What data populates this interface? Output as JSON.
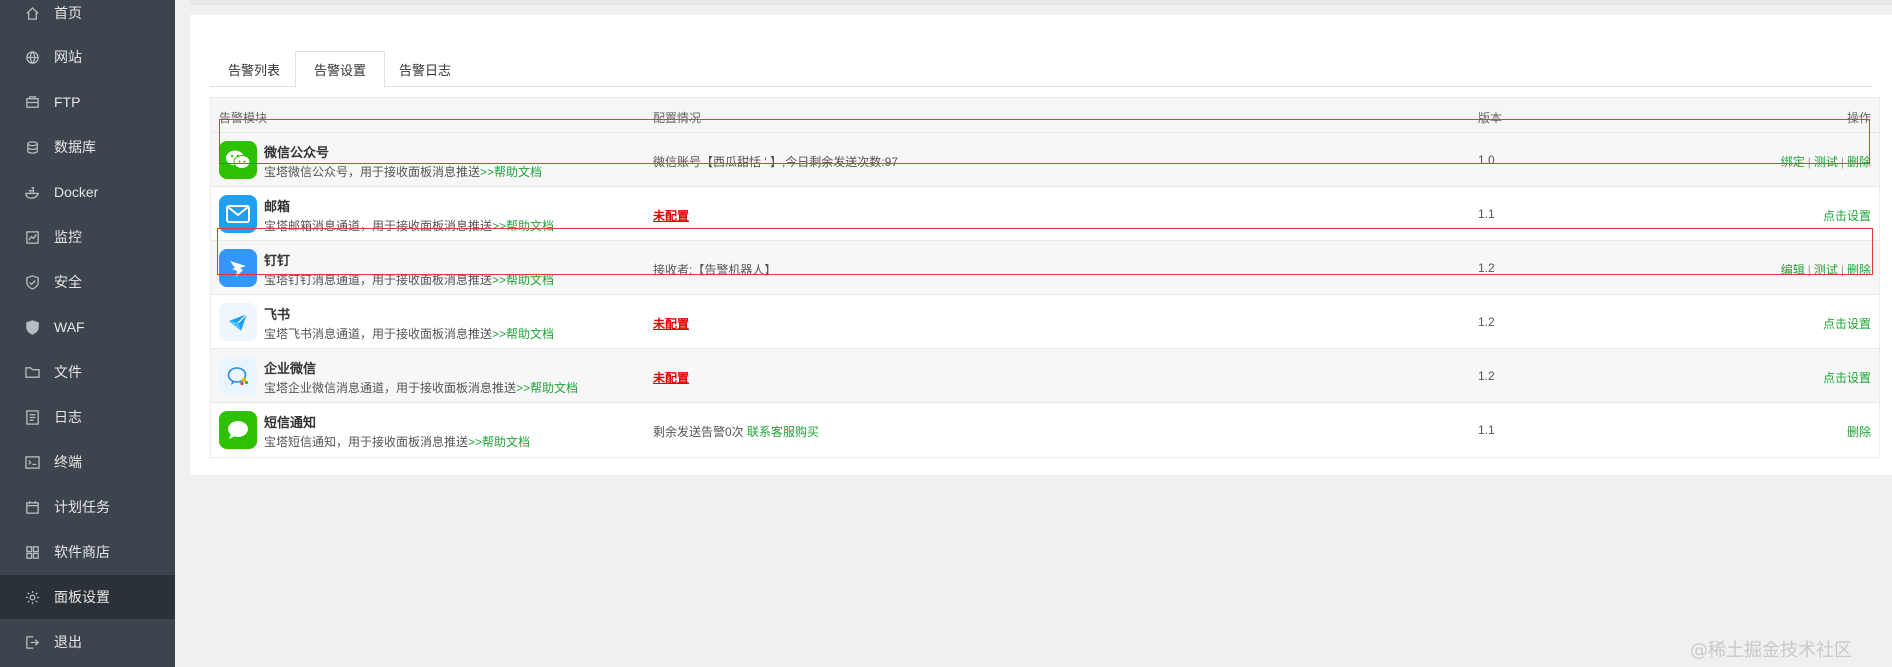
{
  "sidebar": {
    "items": [
      {
        "label": "首页",
        "icon": "home-icon"
      },
      {
        "label": "网站",
        "icon": "globe-icon"
      },
      {
        "label": "FTP",
        "icon": "ftp-icon"
      },
      {
        "label": "数据库",
        "icon": "database-icon"
      },
      {
        "label": "Docker",
        "icon": "docker-icon"
      },
      {
        "label": "监控",
        "icon": "monitor-icon"
      },
      {
        "label": "安全",
        "icon": "shield-icon"
      },
      {
        "label": "WAF",
        "icon": "waf-shield-icon"
      },
      {
        "label": "文件",
        "icon": "folder-icon"
      },
      {
        "label": "日志",
        "icon": "log-icon"
      },
      {
        "label": "终端",
        "icon": "terminal-icon"
      },
      {
        "label": "计划任务",
        "icon": "calendar-icon"
      },
      {
        "label": "软件商店",
        "icon": "grid-icon"
      },
      {
        "label": "面板设置",
        "icon": "gear-icon"
      },
      {
        "label": "退出",
        "icon": "logout-icon"
      }
    ],
    "active_index": 13
  },
  "tabs": [
    {
      "label": "告警列表"
    },
    {
      "label": "告警设置"
    },
    {
      "label": "告警日志"
    }
  ],
  "active_tab": 1,
  "table": {
    "headers": {
      "module": "告警模块",
      "config": "配置情况",
      "version": "版本",
      "ops": "操作"
    },
    "help_link": ">>帮助文档",
    "rows": [
      {
        "title": "微信公众号",
        "desc": "宝塔微信公众号，用于接收面板消息推送",
        "config": "微信账号【西瓜甜恬 ' 】,今日剩余发送次数:97",
        "version": "1.0",
        "ops": [
          "绑定",
          "测试",
          "删除"
        ],
        "icon": "wechat-icon",
        "icon_bg": "#2dc100"
      },
      {
        "title": "邮箱",
        "desc": "宝塔邮箱消息通道，用于接收面板消息推送",
        "config_unset": "未配置",
        "version": "1.1",
        "ops": [
          "点击设置"
        ],
        "icon": "mail-icon",
        "icon_bg": "#1e9ff2"
      },
      {
        "title": "钉钉",
        "desc": "宝塔钉钉消息通道，用于接收面板消息推送",
        "config": "接收者:【告警机器人】",
        "version": "1.2",
        "ops": [
          "编辑",
          "测试",
          "删除"
        ],
        "icon": "dingtalk-icon",
        "icon_bg": "#3296fa"
      },
      {
        "title": "飞书",
        "desc": "宝塔飞书消息通道，用于接收面板消息推送",
        "config_unset": "未配置",
        "version": "1.2",
        "ops": [
          "点击设置"
        ],
        "icon": "feishu-icon",
        "icon_bg": "#eef6fb"
      },
      {
        "title": "企业微信",
        "desc": "宝塔企业微信消息通道，用于接收面板消息推送",
        "config_unset": "未配置",
        "version": "1.2",
        "ops": [
          "点击设置"
        ],
        "icon": "wecom-icon",
        "icon_bg": "#eaf4fd"
      },
      {
        "title": "短信通知",
        "desc": "宝塔短信通知，用于接收面板消息推送",
        "config": "剩余发送告警0次",
        "config_link": "联系客服购买",
        "version": "1.1",
        "ops": [
          "删除"
        ],
        "icon": "sms-icon",
        "icon_bg": "#2dc100"
      }
    ]
  },
  "watermark": "@稀土掘金技术社区",
  "colors": {
    "sidebar_bg": "#3c444d",
    "accent": "#20a53a",
    "danger": "#e30000",
    "highlight": "#e53935"
  }
}
